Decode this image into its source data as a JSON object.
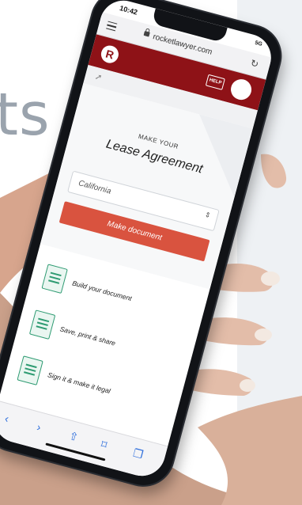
{
  "background": {
    "headline_fragment": "ts"
  },
  "phone": {
    "status": {
      "time": "10:42",
      "signal": "5G"
    },
    "browser": {
      "url": "rocketlawyer.com"
    },
    "appbar": {
      "logo_letter": "R",
      "help_label": "HELP"
    },
    "hero": {
      "eyebrow": "MAKE YOUR",
      "title": "Lease Agreement",
      "state_value": "California",
      "cta_label": "Make document"
    },
    "steps": [
      {
        "label": "Build your document",
        "icon": "document-build-icon"
      },
      {
        "label": "Save, print & share",
        "icon": "document-save-icon"
      },
      {
        "label": "Sign it & make it legal",
        "icon": "document-sign-icon"
      }
    ],
    "toolbar": {
      "back": "‹",
      "forward": "›",
      "share": "⇧",
      "bookmarks": "⌑",
      "tabs": "❐"
    }
  },
  "colors": {
    "brand": "#8e1217",
    "accent": "#d9533f",
    "icon_green": "#2e9b72",
    "ios_blue": "#2f6fdc"
  }
}
